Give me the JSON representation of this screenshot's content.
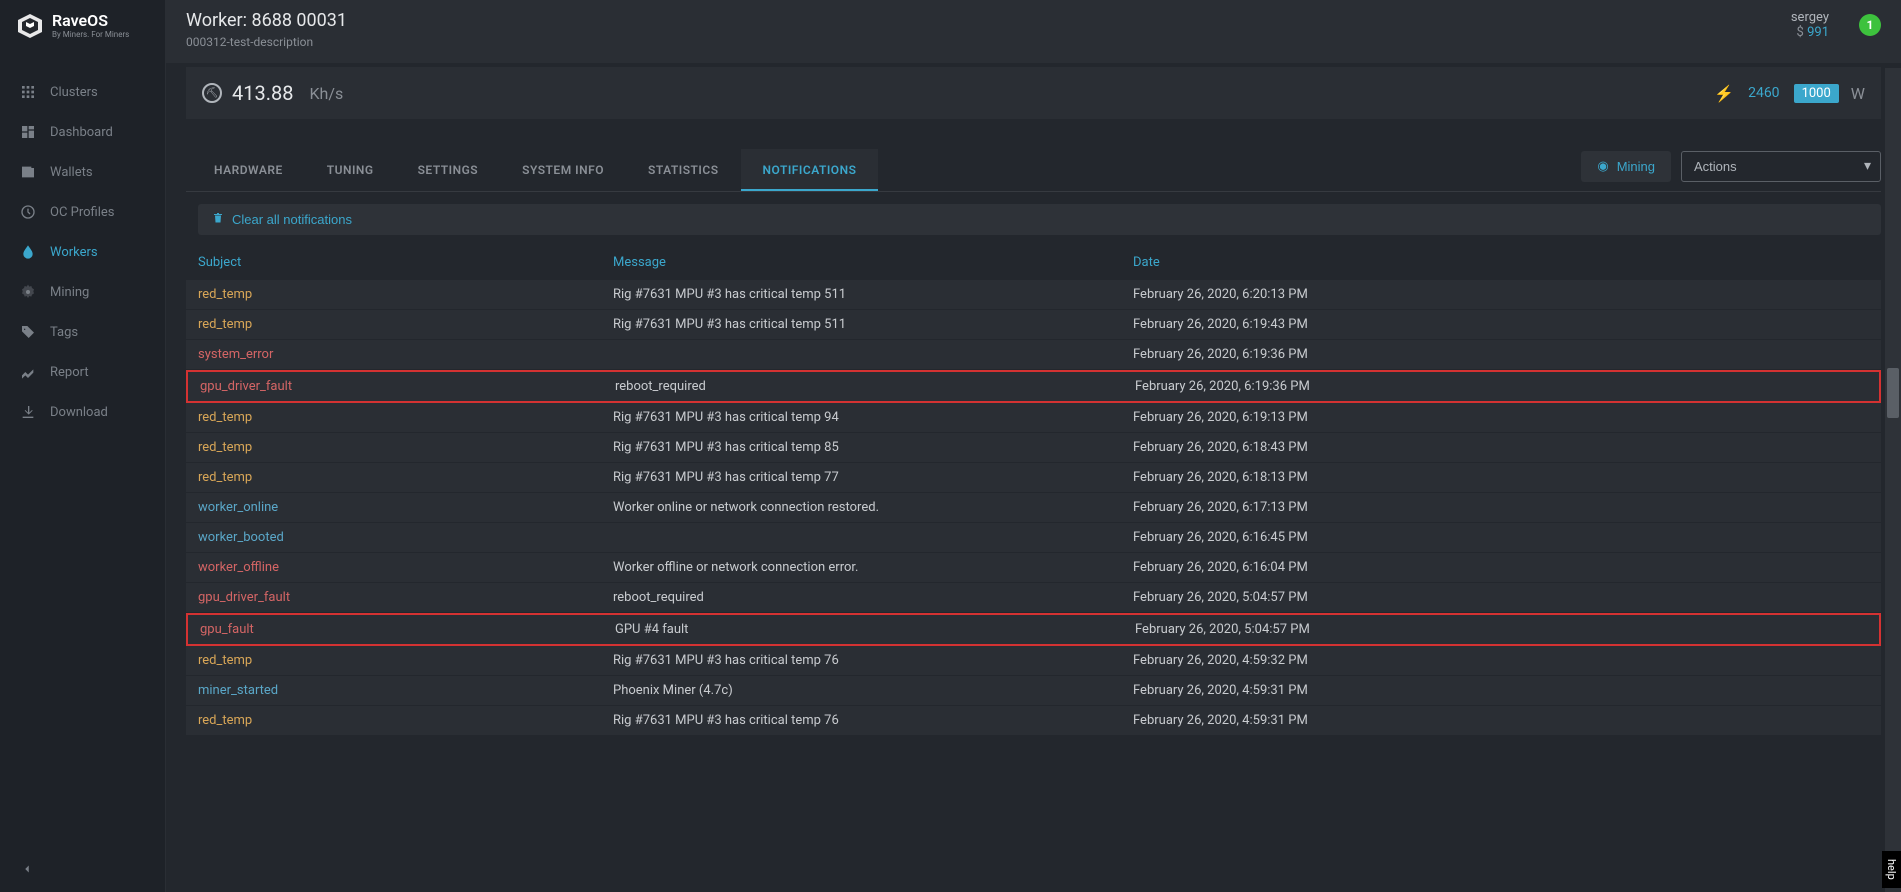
{
  "brand": {
    "name": "RaveOS",
    "tagline": "By Miners. For Miners"
  },
  "sidebar": {
    "items": [
      {
        "label": "Clusters",
        "icon": "grid"
      },
      {
        "label": "Dashboard",
        "icon": "dashboard"
      },
      {
        "label": "Wallets",
        "icon": "wallet"
      },
      {
        "label": "OC Profiles",
        "icon": "clock"
      },
      {
        "label": "Workers",
        "icon": "drop"
      },
      {
        "label": "Mining",
        "icon": "gear"
      },
      {
        "label": "Tags",
        "icon": "tag"
      },
      {
        "label": "Report",
        "icon": "chart"
      },
      {
        "label": "Download",
        "icon": "download"
      }
    ],
    "active_index": 4
  },
  "header": {
    "worker_label": "Worker:",
    "worker_id": "8688 00031",
    "description": "000312-test-description",
    "user": "sergey",
    "currency": "$",
    "balance": "991",
    "badge": "1"
  },
  "hashbar": {
    "value": "413.88",
    "unit": "Kh/s",
    "power_current": "2460",
    "power_limit": "1000",
    "power_unit": "W"
  },
  "tabs": {
    "items": [
      "HARDWARE",
      "TUNING",
      "SETTINGS",
      "SYSTEM INFO",
      "STATISTICS",
      "NOTIFICATIONS"
    ],
    "active_index": 5,
    "mining_btn": "Mining",
    "actions_sel": "Actions"
  },
  "notifications": {
    "clear_btn": "Clear all notifications",
    "columns": {
      "subject": "Subject",
      "message": "Message",
      "date": "Date"
    },
    "rows": [
      {
        "subject": "red_temp",
        "level": "warning",
        "message": "Rig #7631 MPU #3 has critical temp 511",
        "date": "February 26, 2020, 6:20:13 PM",
        "highlighted": false
      },
      {
        "subject": "red_temp",
        "level": "warning",
        "message": "Rig #7631 MPU #3 has critical temp 511",
        "date": "February 26, 2020, 6:19:43 PM",
        "highlighted": false
      },
      {
        "subject": "system_error",
        "level": "error",
        "message": "",
        "date": "February 26, 2020, 6:19:36 PM",
        "highlighted": false
      },
      {
        "subject": "gpu_driver_fault",
        "level": "error",
        "message": "reboot_required",
        "date": "February 26, 2020, 6:19:36 PM",
        "highlighted": true
      },
      {
        "subject": "red_temp",
        "level": "warning",
        "message": "Rig #7631 MPU #3 has critical temp 94",
        "date": "February 26, 2020, 6:19:13 PM",
        "highlighted": false
      },
      {
        "subject": "red_temp",
        "level": "warning",
        "message": "Rig #7631 MPU #3 has critical temp 85",
        "date": "February 26, 2020, 6:18:43 PM",
        "highlighted": false
      },
      {
        "subject": "red_temp",
        "level": "warning",
        "message": "Rig #7631 MPU #3 has critical temp 77",
        "date": "February 26, 2020, 6:18:13 PM",
        "highlighted": false
      },
      {
        "subject": "worker_online",
        "level": "info",
        "message": "Worker online or network connection restored.",
        "date": "February 26, 2020, 6:17:13 PM",
        "highlighted": false
      },
      {
        "subject": "worker_booted",
        "level": "info",
        "message": "",
        "date": "February 26, 2020, 6:16:45 PM",
        "highlighted": false
      },
      {
        "subject": "worker_offline",
        "level": "error",
        "message": "Worker offline or network connection error.",
        "date": "February 26, 2020, 6:16:04 PM",
        "highlighted": false
      },
      {
        "subject": "gpu_driver_fault",
        "level": "error",
        "message": "reboot_required",
        "date": "February 26, 2020, 5:04:57 PM",
        "highlighted": false
      },
      {
        "subject": "gpu_fault",
        "level": "error",
        "message": "GPU #4 fault",
        "date": "February 26, 2020, 5:04:57 PM",
        "highlighted": true
      },
      {
        "subject": "red_temp",
        "level": "warning",
        "message": "Rig #7631 MPU #3 has critical temp 76",
        "date": "February 26, 2020, 4:59:32 PM",
        "highlighted": false
      },
      {
        "subject": "miner_started",
        "level": "info",
        "message": "Phoenix Miner (4.7c)",
        "date": "February 26, 2020, 4:59:31 PM",
        "highlighted": false
      },
      {
        "subject": "red_temp",
        "level": "warning",
        "message": "Rig #7631 MPU #3 has critical temp 76",
        "date": "February 26, 2020, 4:59:31 PM",
        "highlighted": false
      }
    ]
  },
  "help_label": "help"
}
